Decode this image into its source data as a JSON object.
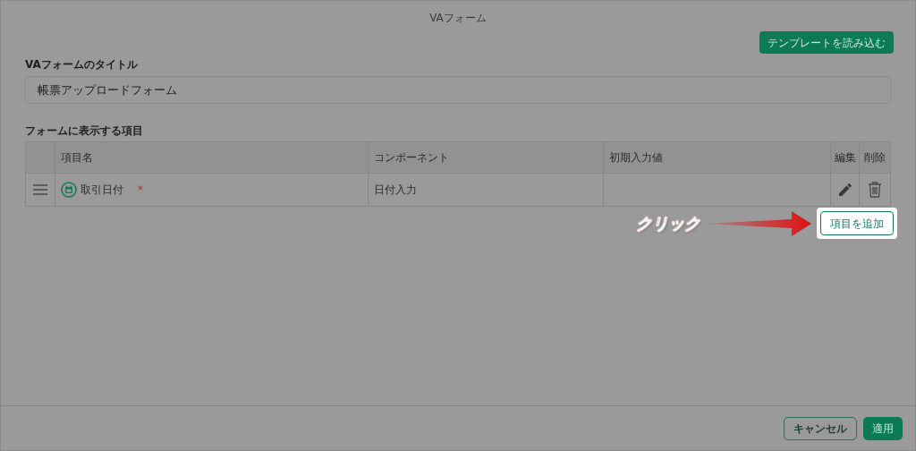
{
  "dialog": {
    "title": "VAフォーム",
    "template_button": "テンプレートを読み込む"
  },
  "form_title": {
    "label": "VAフォームのタイトル",
    "value": "帳票アップロードフォーム"
  },
  "items_section": {
    "label": "フォームに表示する項目",
    "columns": [
      "項目名",
      "コンポーネント",
      "初期入力値",
      "編集",
      "削除"
    ],
    "rows": [
      {
        "name": "取引日付",
        "required_mark": "*",
        "component": "日付入力"
      }
    ],
    "add_button": "項目を追加"
  },
  "annotation": {
    "text": "クリック"
  },
  "footer": {
    "buttons": [
      {
        "label": "キャンセル",
        "kind": "secondary"
      },
      {
        "label": "適用",
        "kind": "primary"
      }
    ]
  }
}
